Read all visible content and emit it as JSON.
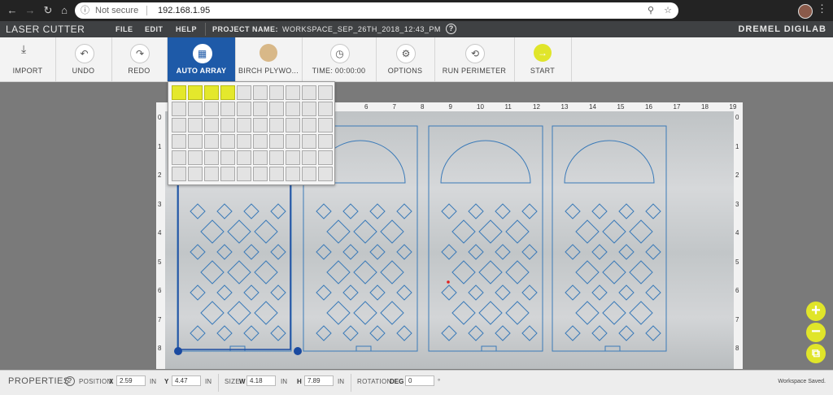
{
  "browser": {
    "back": "←",
    "forward": "→",
    "reload": "↻",
    "home": "⌂",
    "info_icon": "ⓘ",
    "security": "Not secure",
    "url": "192.168.1.95",
    "zoom_icon": "⚲",
    "star_icon": "☆",
    "menu_icon": "⋮"
  },
  "app": {
    "title": "LASER CUTTER",
    "menu": [
      "FILE",
      "EDIT",
      "HELP"
    ],
    "project_label": "PROJECT NAME:",
    "project_name": "WORKSPACE_SEP_26TH_2018_12:43_PM",
    "help_glyph": "?",
    "brand": "DREMEL DIGILAB"
  },
  "toolbar": {
    "import": {
      "label": "IMPORT",
      "icon": "⤓"
    },
    "undo": {
      "label": "UNDO",
      "icon": "↶"
    },
    "redo": {
      "label": "REDO",
      "icon": "↷"
    },
    "auto_array": {
      "label": "AUTO ARRAY",
      "icon": "▦"
    },
    "material": {
      "label": "BIRCH PLYWO...",
      "color": "#d8b888"
    },
    "time": {
      "label": "TIME: 00:00:00",
      "icon": "◷"
    },
    "options": {
      "label": "OPTIONS",
      "icon": "⚙"
    },
    "run_perimeter": {
      "label": "RUN PERIMETER",
      "icon": "⟲"
    },
    "start": {
      "label": "START",
      "icon": "→",
      "color": "#e0e52a"
    }
  },
  "auto_array": {
    "rows": 6,
    "cols": 10,
    "selected_rows": 1,
    "selected_cols": 4
  },
  "ruler": {
    "top": [
      "6",
      "7",
      "8",
      "9",
      "10",
      "11",
      "12",
      "13",
      "14",
      "15",
      "16",
      "17",
      "18",
      "19"
    ],
    "left": [
      "0",
      "1",
      "2",
      "3",
      "4",
      "5",
      "6",
      "7",
      "8"
    ],
    "right": [
      "0",
      "1",
      "2",
      "3",
      "4",
      "5",
      "6",
      "7",
      "8"
    ]
  },
  "properties": {
    "title": "PROPERTIES",
    "help_glyph": "?",
    "position_label": "POSITION",
    "x_label": "X",
    "x_value": "2.59",
    "y_label": "Y",
    "y_value": "4.47",
    "size_label": "SIZE",
    "w_label": "W",
    "w_value": "4.18",
    "h_label": "H",
    "h_value": "7.89",
    "rotation_label": "ROTATION",
    "deg_label": "DEG",
    "rotation_value": "0",
    "degree_symbol": "°",
    "unit": "IN",
    "status": "Workspace Saved."
  },
  "zoom": {
    "in": "+",
    "out": "−",
    "fit": "⧉"
  },
  "colors": {
    "accent_blue": "#1e5aa8",
    "accent_yellow": "#e0e52a",
    "path_blue": "#3a7ab8",
    "selection_blue": "#1a4aa0"
  }
}
